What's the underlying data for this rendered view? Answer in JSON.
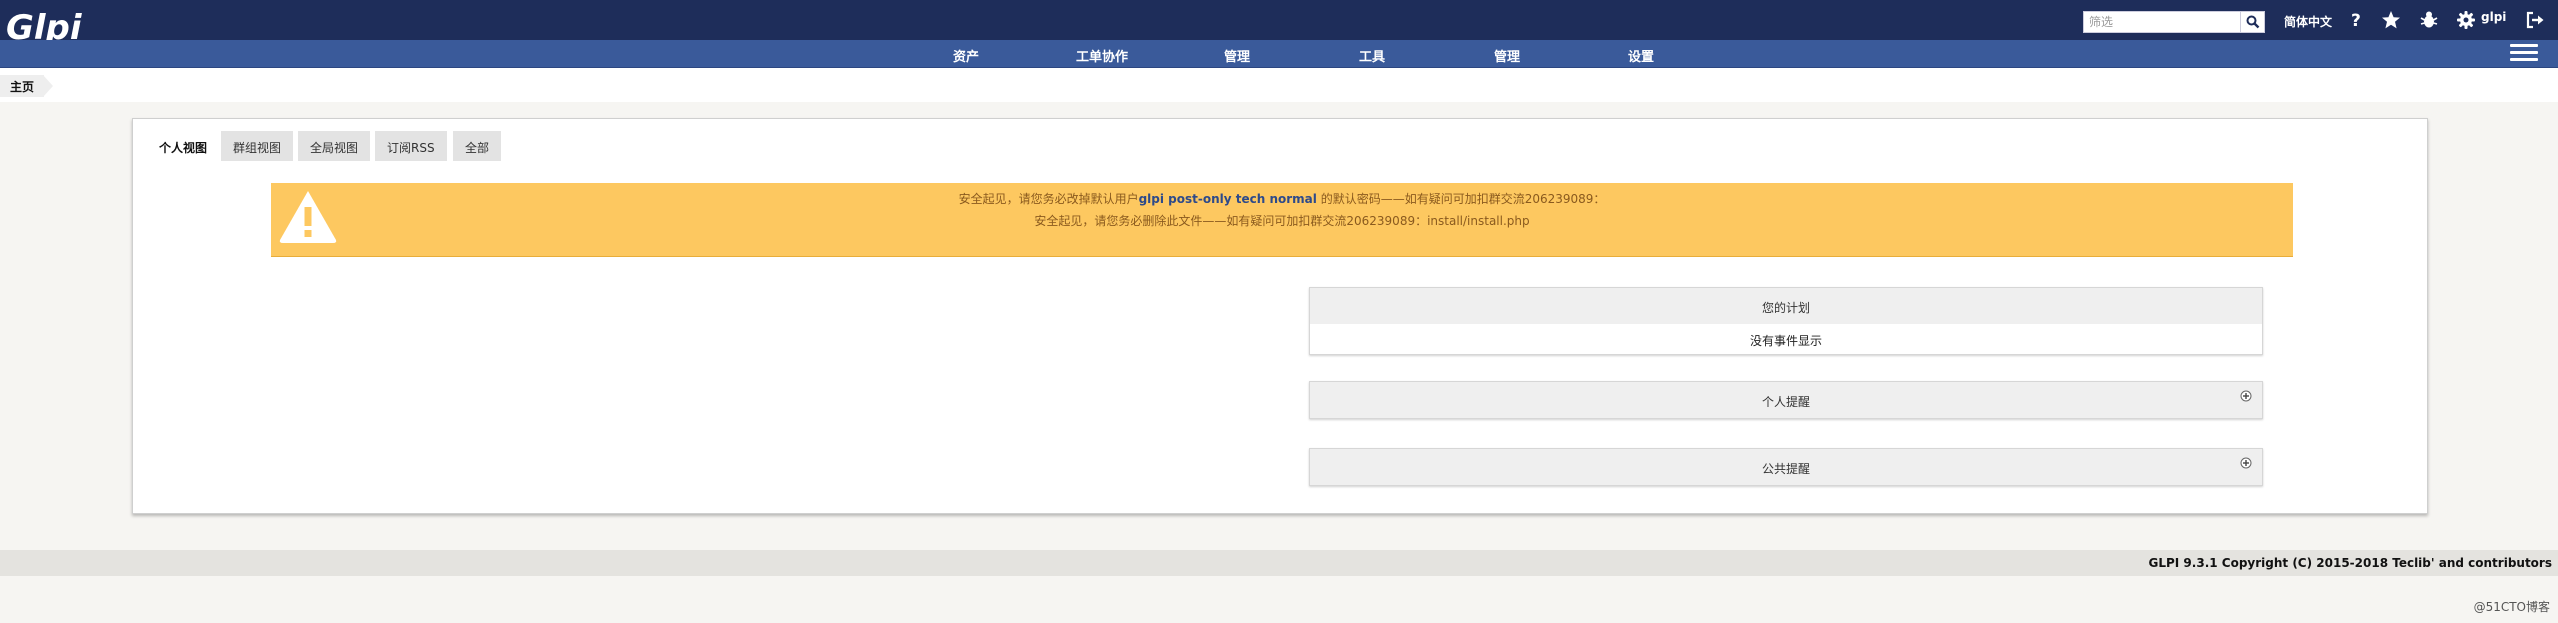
{
  "header": {
    "logo_text": "Glpi",
    "search_placeholder": "筛选",
    "language": "简体中文",
    "user": "glpi",
    "icons": [
      "help-icon",
      "star-icon",
      "bug-icon",
      "gear-icon",
      "logout-icon"
    ]
  },
  "nav": {
    "items": [
      "资产",
      "工单协作",
      "管理",
      "工具",
      "管理",
      "设置"
    ]
  },
  "breadcrumb": {
    "home": "主页"
  },
  "tabs": [
    "个人视图",
    "群组视图",
    "全局视图",
    "订阅RSS",
    "全部"
  ],
  "alert": {
    "line1_pre": "安全起见，请您务必改掉默认用户",
    "line1_users": "glpi post-only tech normal",
    "line1_post": " 的默认密码——如有疑问可加扣群交流206239089：",
    "line2": "安全起见，请您务必删除此文件——如有疑问可加扣群交流206239089：install/install.php"
  },
  "panels": {
    "plan_title": "您的计划",
    "plan_empty": "没有事件显示",
    "personal_reminders": "个人提醒",
    "public_reminders": "公共提醒"
  },
  "footer": {
    "copyright": "GLPI 9.3.1 Copyright (C) 2015-2018 Teclib' and contributors"
  },
  "watermark": "@51CTO博客",
  "colors": {
    "header_bg": "#1e2d5a",
    "nav_bg": "#3a5a9a",
    "alert_bg": "#fdc860"
  }
}
